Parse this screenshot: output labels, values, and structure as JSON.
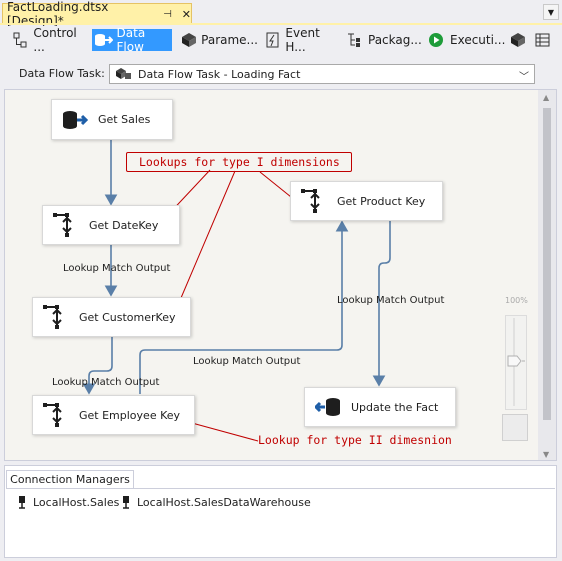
{
  "document_tab": {
    "title": "FactLoading.dtsx [Design]*",
    "pin": "⊣",
    "close": "✕"
  },
  "designer_tabs": [
    {
      "label": "Control ...",
      "icon": "control-flow-icon",
      "active": false
    },
    {
      "label": "Data Flow",
      "icon": "data-flow-icon",
      "active": true
    },
    {
      "label": "Parame...",
      "icon": "parameters-icon",
      "active": false
    },
    {
      "label": "Event H...",
      "icon": "event-handlers-icon",
      "active": false
    },
    {
      "label": "Packag...",
      "icon": "package-explorer-icon",
      "active": false
    },
    {
      "label": "Executi...",
      "icon": "execution-results-icon",
      "active": false
    }
  ],
  "data_flow_task": {
    "label": "Data Flow Task:",
    "value": "Data Flow Task - Loading Fact"
  },
  "components": {
    "get_sales": "Get Sales",
    "get_datekey": "Get DateKey",
    "get_customerkey": "Get CustomerKey",
    "get_employee_key": "Get Employee Key",
    "get_product_key": "Get Product Key",
    "update_fact": "Update the Fact"
  },
  "path_labels": {
    "datekey_out": "Lookup Match Output",
    "customer_out": "Lookup Match Output",
    "employee_out": "Lookup Match Output",
    "product_out": "Lookup Match Output"
  },
  "annotations": {
    "type1": "Lookups for type I dimensions",
    "type2": "Lookup for type II dimesnion"
  },
  "zoom": {
    "label": "100%"
  },
  "connection_managers": {
    "tab_label": "Connection Managers",
    "items": [
      "LocalHost.Sales",
      "LocalHost.SalesDataWarehouse"
    ]
  },
  "colors": {
    "accent": "#3399ff",
    "tab_yellow": "#fff1a8",
    "annotation_red": "#c00000",
    "path_blue": "#5a7fa8"
  }
}
